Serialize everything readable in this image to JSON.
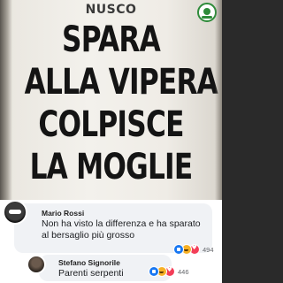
{
  "poster": {
    "header": "NUSCO",
    "headline": [
      "SPARA",
      "ALLA VIPERA",
      "COLPISCE",
      "LA MOGLIE"
    ],
    "logo_icon": "circular-green-badge-icon"
  },
  "comments": [
    {
      "author": "Mario Rossi",
      "text": "Non ha visto la differenza e ha sparato al bersaglio più grosso",
      "reaction_icons": [
        "like-icon",
        "haha-icon",
        "love-icon"
      ],
      "reaction_count": "494"
    },
    {
      "author": "Stefano Signorile",
      "text": "Parenti serpenti",
      "reaction_icons": [
        "like-icon",
        "haha-icon",
        "love-icon"
      ],
      "reaction_count": "446"
    }
  ],
  "colors": {
    "like": "#1877f2",
    "haha": "#f7b125",
    "love": "#f33e58",
    "bubble": "#f0f2f5",
    "logo_green": "#2e8b3a"
  }
}
